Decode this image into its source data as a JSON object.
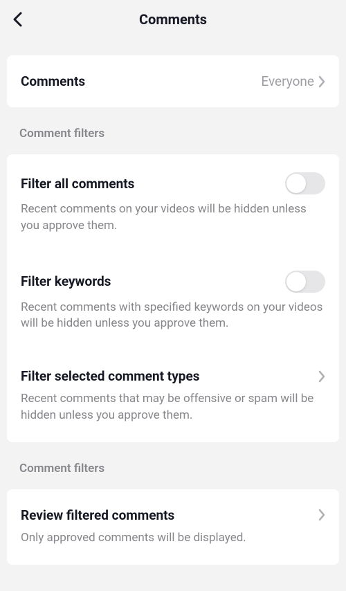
{
  "header": {
    "title": "Comments"
  },
  "permission": {
    "label": "Comments",
    "value": "Everyone"
  },
  "section1": {
    "label": "Comment filters"
  },
  "filterAll": {
    "title": "Filter all comments",
    "desc": "Recent comments on your videos will be hidden unless you approve them."
  },
  "filterKeywords": {
    "title": "Filter keywords",
    "desc": "Recent comments with specified keywords on your videos will be hidden unless you approve them."
  },
  "filterTypes": {
    "title": "Filter selected comment types",
    "desc": "Recent comments that may be offensive or spam will be hidden unless you approve them."
  },
  "section2": {
    "label": "Comment filters"
  },
  "review": {
    "title": "Review filtered comments",
    "desc": "Only approved comments will be displayed."
  }
}
